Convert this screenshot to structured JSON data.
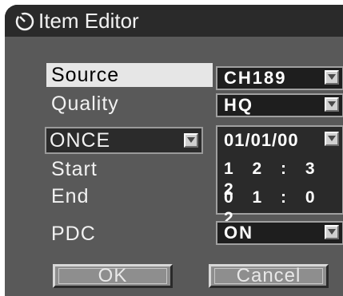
{
  "window": {
    "title": "Item Editor",
    "icon": "timer-icon"
  },
  "fields": {
    "source": {
      "label": "Source",
      "value": "CH189"
    },
    "quality": {
      "label": "Quality",
      "value": "HQ"
    },
    "repeat": {
      "value": "ONCE"
    },
    "date": {
      "value": "01/01/00"
    },
    "start": {
      "label": "Start",
      "value": "1 2 : 3 2"
    },
    "end": {
      "label": "End",
      "value": "0 1 : 0 2"
    },
    "pdc": {
      "label": "PDC",
      "value": "ON"
    }
  },
  "buttons": {
    "ok": "OK",
    "cancel": "Cancel"
  },
  "colors": {
    "panel": "#595959",
    "title_bar": "#2a2a2a",
    "selected_row": "#e6e6e6",
    "field_bg": "#1e1e1e"
  }
}
